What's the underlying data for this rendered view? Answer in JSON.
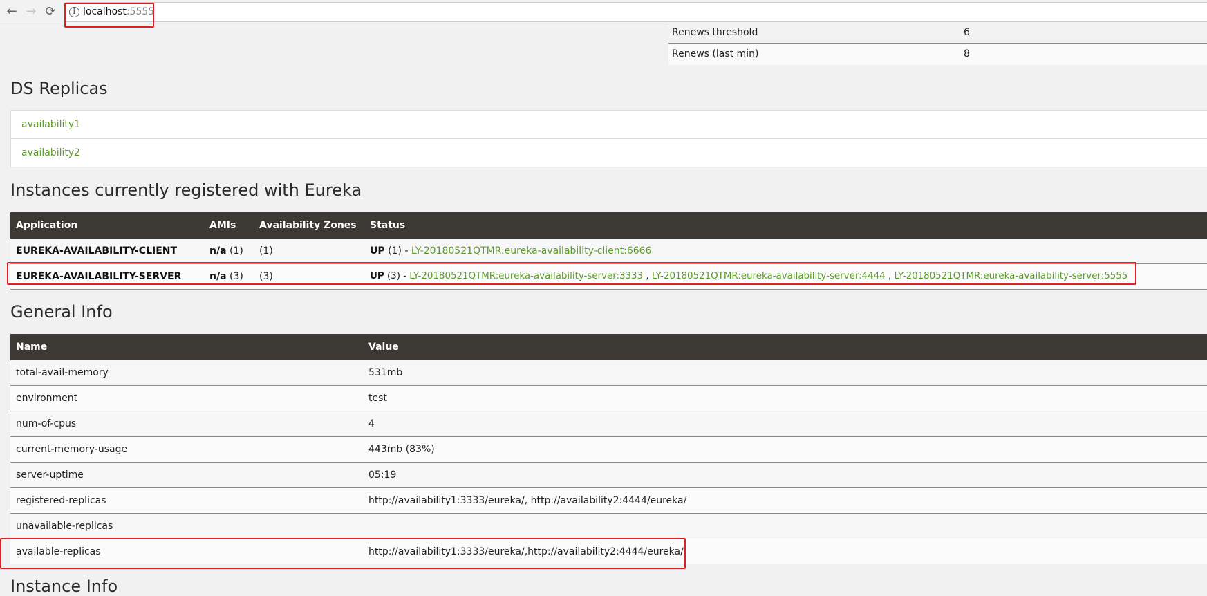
{
  "browser": {
    "url_host": "localhost",
    "url_port": ":5555",
    "back_glyph": "←",
    "forward_glyph": "→",
    "reload_glyph": "⟳",
    "info_glyph": "i"
  },
  "status": {
    "rows": [
      {
        "name": "Renews threshold",
        "value": "6"
      },
      {
        "name": "Renews (last min)",
        "value": "8"
      }
    ]
  },
  "ds_replicas": {
    "title": "DS Replicas",
    "items": [
      "availability1",
      "availability2"
    ]
  },
  "instances": {
    "title": "Instances currently registered with Eureka",
    "headers": [
      "Application",
      "AMIs",
      "Availability Zones",
      "Status"
    ],
    "rows": [
      {
        "application": "EUREKA-AVAILABILITY-CLIENT",
        "amis_bold": "n/a",
        "amis_count": " (1)",
        "zones": "(1)",
        "status_prefix": "UP",
        "status_count": " (1) - ",
        "links": [
          "LY-20180521QTMR:eureka-availability-client:6666"
        ]
      },
      {
        "application": "EUREKA-AVAILABILITY-SERVER",
        "amis_bold": "n/a",
        "amis_count": " (3)",
        "zones": "(3)",
        "status_prefix": "UP",
        "status_count": " (3) - ",
        "links": [
          "LY-20180521QTMR:eureka-availability-server:3333",
          "LY-20180521QTMR:eureka-availability-server:4444",
          "LY-20180521QTMR:eureka-availability-server:5555"
        ],
        "link_separator": " , "
      }
    ]
  },
  "general_info": {
    "title": "General Info",
    "headers": [
      "Name",
      "Value"
    ],
    "rows": [
      {
        "name": "total-avail-memory",
        "value": "531mb"
      },
      {
        "name": "environment",
        "value": "test"
      },
      {
        "name": "num-of-cpus",
        "value": "4"
      },
      {
        "name": "current-memory-usage",
        "value": "443mb (83%)"
      },
      {
        "name": "server-uptime",
        "value": "05:19"
      },
      {
        "name": "registered-replicas",
        "value": "http://availability1:3333/eureka/, http://availability2:4444/eureka/"
      },
      {
        "name": "unavailable-replicas",
        "value": ""
      },
      {
        "name": "available-replicas",
        "value": "http://availability1:3333/eureka/,http://availability2:4444/eureka/,"
      }
    ]
  },
  "next_section": {
    "title": "Instance Info"
  },
  "colors": {
    "link": "#5d9b2c",
    "header_bg": "#3c3834",
    "highlight": "#e02020"
  }
}
